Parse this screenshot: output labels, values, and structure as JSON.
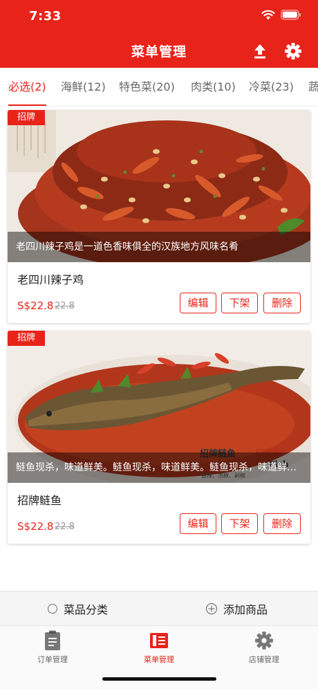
{
  "status_bar": {
    "time": "7:33"
  },
  "header": {
    "title": "菜单管理"
  },
  "tabs": [
    {
      "label": "必选(2)",
      "active": true
    },
    {
      "label": "海鲜(12)",
      "active": false
    },
    {
      "label": "特色菜(20)",
      "active": false
    },
    {
      "label": "肉类(10)",
      "active": false
    },
    {
      "label": "冷菜(23)",
      "active": false
    },
    {
      "label": "蔬",
      "active": false
    }
  ],
  "dishes": [
    {
      "badge": "招牌",
      "caption": "老四川辣子鸡是一道色香味俱全的汉族地方风味名肴",
      "name": "老四川辣子鸡",
      "price": "S$22.8",
      "original_price": "22.8",
      "actions": {
        "edit": "编辑",
        "off_shelf": "下架",
        "delete": "删除"
      }
    },
    {
      "badge": "招牌",
      "caption": "鲢鱼现杀，味道鲜美。鲢鱼现杀，味道鲜美。鲢鱼现杀，味道鲜美。",
      "name": "招牌鲢鱼",
      "price": "S$22.8",
      "original_price": "22.8",
      "actions": {
        "edit": "编辑",
        "off_shelf": "下架",
        "delete": "删除"
      },
      "photo_text": {
        "title": "招牌鲢鱼",
        "price": "$22.80",
        "english": "Fish",
        "sub": "香辣、泡椒、剁椒"
      }
    }
  ],
  "action_bar": {
    "category": "菜品分类",
    "add": "添加商品"
  },
  "tabbar": [
    {
      "label": "订单管理",
      "active": false,
      "icon": "clipboard-icon"
    },
    {
      "label": "菜单管理",
      "active": true,
      "icon": "menu-book-icon"
    },
    {
      "label": "店铺管理",
      "active": false,
      "icon": "gear-icon"
    }
  ],
  "colors": {
    "brand": "#e8231a"
  }
}
